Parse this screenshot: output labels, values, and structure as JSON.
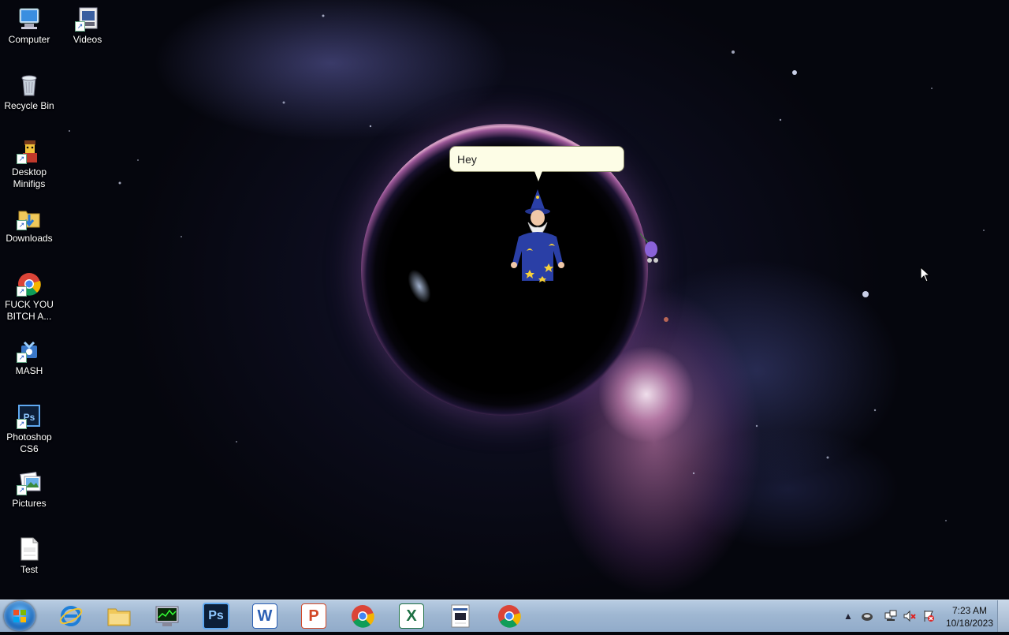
{
  "desktop": {
    "icons": [
      {
        "label": "Computer",
        "icon": "computer-icon"
      },
      {
        "label": "Videos",
        "icon": "videos-folder-icon"
      },
      {
        "label": "Recycle Bin",
        "icon": "recycle-bin-icon"
      },
      {
        "label": "Desktop Minifigs",
        "icon": "minifig-icon"
      },
      {
        "label": "Downloads",
        "icon": "downloads-folder-icon"
      },
      {
        "label": "FUCK YOU BITCH A...",
        "icon": "chrome-shortcut-icon"
      },
      {
        "label": "MASH",
        "icon": "mash-icon"
      },
      {
        "label": "Photoshop CS6",
        "icon": "photoshop-icon"
      },
      {
        "label": "Pictures",
        "icon": "pictures-folder-icon"
      },
      {
        "label": "Test",
        "icon": "docx-file-icon"
      }
    ]
  },
  "agent": {
    "speech": "Hey",
    "character": "wizard-character"
  },
  "taskbar": {
    "pinned": [
      {
        "name": "internet-explorer",
        "icon": "internet-explorer-icon"
      },
      {
        "name": "file-explorer",
        "icon": "folder-icon"
      },
      {
        "name": "task-manager",
        "icon": "task-manager-icon"
      },
      {
        "name": "photoshop",
        "icon": "photoshop-icon",
        "text": "Ps"
      },
      {
        "name": "word",
        "icon": "word-icon",
        "text": "W"
      },
      {
        "name": "powerpoint",
        "icon": "powerpoint-icon",
        "text": "P"
      },
      {
        "name": "chrome",
        "icon": "chrome-icon"
      },
      {
        "name": "excel",
        "icon": "excel-icon",
        "text": "X"
      },
      {
        "name": "app-window",
        "icon": "window-app-icon"
      },
      {
        "name": "chrome-2",
        "icon": "chrome-icon"
      }
    ],
    "time": "7:23 AM",
    "date": "10/18/2023"
  },
  "colors": {
    "taskbar": "#9fb7d2",
    "bubble": "#fdfde6",
    "accent_nebula": "#e08ac8"
  }
}
